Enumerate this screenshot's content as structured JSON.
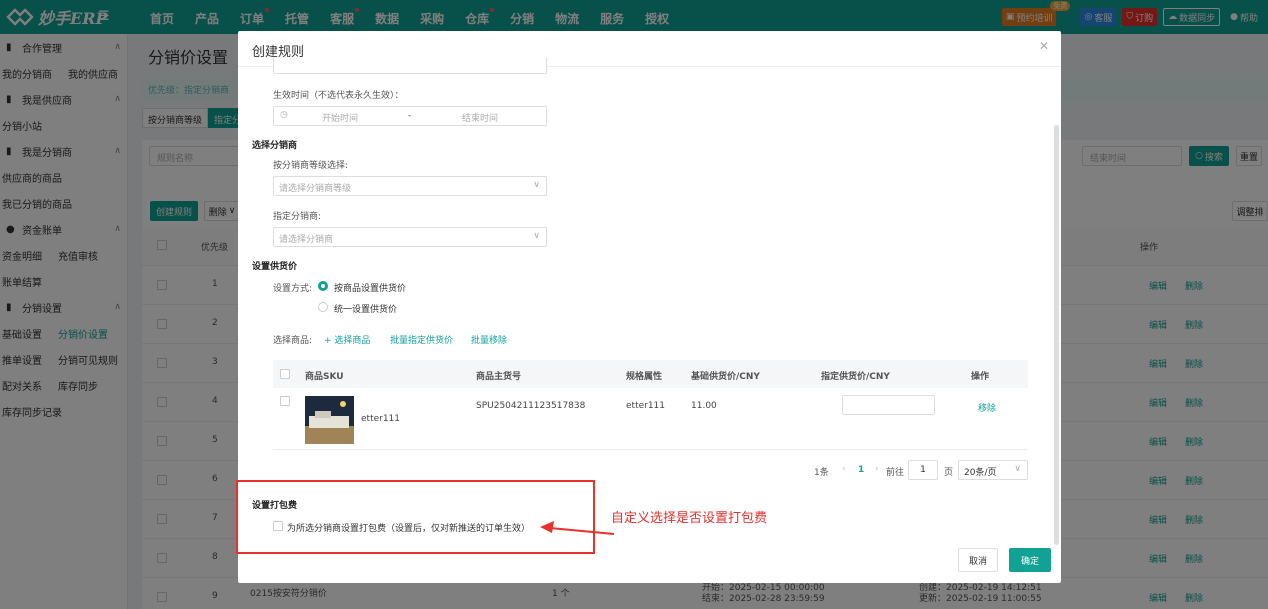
{
  "topbar": {
    "app_name": "妙手ERP",
    "nav": [
      {
        "label": "首页",
        "dot": false
      },
      {
        "label": "产品",
        "dot": false
      },
      {
        "label": "订单",
        "dot": true
      },
      {
        "label": "托管",
        "dot": false
      },
      {
        "label": "客服",
        "dot": true
      },
      {
        "label": "数据",
        "dot": false
      },
      {
        "label": "采购",
        "dot": false
      },
      {
        "label": "仓库",
        "dot": true
      },
      {
        "label": "分销",
        "dot": false
      },
      {
        "label": "物流",
        "dot": false
      },
      {
        "label": "服务",
        "dot": false
      },
      {
        "label": "授权",
        "dot": false
      }
    ],
    "book_training": "预约培训",
    "book_badge": "免费",
    "service": "客服",
    "subscribe": "订购",
    "sync": "数据同步",
    "help": "帮助"
  },
  "sidebar": {
    "groups": [
      {
        "title": "合作管理",
        "items": [
          "我的分销商",
          "我的供应商"
        ]
      },
      {
        "title": "我是供应商",
        "items": [
          "分销小站"
        ]
      },
      {
        "title": "我是分销商",
        "items": [
          "供应商的商品"
        ]
      },
      {
        "title": "",
        "items": [
          "我已分销的商品"
        ]
      },
      {
        "title": "资金账单",
        "items": [
          "资金明细",
          "充值审核"
        ]
      },
      {
        "title": "",
        "items": [
          "账单结算"
        ]
      },
      {
        "title": "分销设置",
        "items": [
          "基础设置",
          "分销价设置"
        ]
      },
      {
        "title": "",
        "items": [
          "推单设置",
          "分销可见规则"
        ]
      },
      {
        "title": "",
        "items": [
          "配对关系",
          "库存同步"
        ]
      },
      {
        "title": "",
        "items": [
          "库存同步记录"
        ]
      }
    ],
    "active_item": "分销价设置"
  },
  "page": {
    "title": "分销价设置",
    "hint": "优先级：指定分销商",
    "tab_level": "按分销商等级",
    "tab_specific": "指定分",
    "filter_rule_name": "规则名称",
    "filter_end_time": "结束时间",
    "search": "搜索",
    "reset": "重置",
    "create_rule": "创建规则",
    "delete": "删除",
    "adjust": "调整排",
    "col_priority": "优先级",
    "col_ops": "操作",
    "edit": "编辑",
    "remove": "删除",
    "rows": [
      "1",
      "2",
      "3",
      "4",
      "5",
      "6",
      "7",
      "8",
      "9"
    ],
    "row9_name": "0215按安符分销价",
    "row9_count": "1 个",
    "row9_start": "开始：2025-02-15 00:00:00",
    "row9_end": "结束：2025-02-28 23:59:59",
    "row9_created": "创建：2025-02-19 14:12:51",
    "row9_updated": "更新：2025-02-19 11:00:55"
  },
  "modal": {
    "title": "创建规则",
    "effective_label": "生效时间（不选代表永久生效）：",
    "start_placeholder": "开始时间",
    "range_sep": "-",
    "end_placeholder": "结束时间",
    "select_distributor": "选择分销商",
    "by_level_label": "按分销商等级选择:",
    "level_placeholder": "请选择分销商等级",
    "specific_label": "指定分销商:",
    "specific_placeholder": "请选择分销商",
    "set_price_title": "设置供货价",
    "set_mode_label": "设置方式:",
    "mode_by_product": "按商品设置供货价",
    "mode_unified": "统一设置供货价",
    "select_products_label": "选择商品:",
    "add_products": "+ 选择商品",
    "batch_price": "批量指定供货价",
    "batch_remove": "批量移除",
    "table": {
      "headers": [
        "商品SKU",
        "商品主货号",
        "规格属性",
        "基础供货价/CNY",
        "指定供货价/CNY",
        "操作"
      ],
      "row": {
        "sku": "etter111",
        "spu": "SPU2504211123517838",
        "spec": "etter111",
        "base_price": "11.00",
        "op": "移除"
      }
    },
    "pagination": {
      "total": "1条",
      "current": "1",
      "goto": "前往",
      "page_val": "1",
      "page_unit": "页",
      "page_size": "20条/页"
    },
    "packing_title": "设置打包费",
    "packing_checkbox": "为所选分销商设置打包费（设置后，仅对新推送的订单生效）",
    "cancel": "取消",
    "confirm": "确定"
  },
  "annotation": {
    "text": "自定义选择是否设置打包费",
    "color": "#e8302c"
  },
  "colors": {
    "brand": "#11a195",
    "accent_red": "#e8302c"
  }
}
